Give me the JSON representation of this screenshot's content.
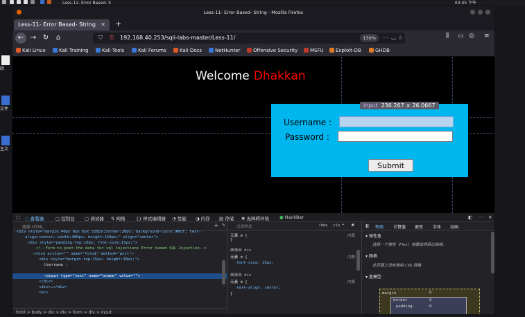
{
  "os": {
    "taskbar_item": "Less-11- Error Based- S",
    "clock": "03:45 下午"
  },
  "desktop": {
    "icon_labels": [
      "回",
      "文件",
      "主文"
    ]
  },
  "browser": {
    "window_title": "Less-11- Error Based- String - Mozilla Firefox",
    "tab_label": "Less-11- Error Based- String",
    "url": "192.168.40.253/sqli-labs-master/Less-11/",
    "zoom": "130%",
    "bookmarks": [
      "Kali Linux",
      "Kali Training",
      "Kali Tools",
      "Kali Forums",
      "Kali Docs",
      "NetHunter",
      "Offensive Security",
      "MSFU",
      "Exploit-DB",
      "GHDB"
    ]
  },
  "page": {
    "welcome": "Welcome",
    "name": "Dhakkan",
    "username_label": "Username :",
    "password_label": "Password :",
    "submit_label": "Submit",
    "inspect_tag": "input",
    "inspect_size": "236.267 × 26.0667"
  },
  "devtools": {
    "tabs": [
      "查看器",
      "控制台",
      "调试器",
      "网络",
      "样式编辑器",
      "性能",
      "内存",
      "存储",
      "无障碍环境",
      "HackBar"
    ],
    "search_placeholder": "搜索 HTML",
    "html_lines": [
      "<div style=\"margin:40px 0px 0px 520px;border:20px; background-color:#0CF; text-",
      "align:center; width:400px; height:150px;\" align=\"center\">",
      "<div style=\"padding-top:10px; font-size:15px;\">",
      "<!--Form to post the data for sql injections Error based SQL Injection-->",
      "<form action=\"\" name=\"form1\" method=\"post\">",
      "<div style=\"margin-top:15px; height:30px;\">",
      "Username :",
      "<input type=\"text\" name=\"uname\" value=\"\">",
      "</div>",
      "<div>…</div>",
      "<br>"
    ],
    "breadcrumbs": "html > body > div > div > form > div > input",
    "rules_filter": "过滤样式",
    "rules_toggles": [
      ":hov",
      ".cls"
    ],
    "rules": [
      {
        "selector": "元素 ⚙ {",
        "body": "}",
        "source": "内联"
      },
      {
        "selector": "继承自 div",
        "body": "",
        "source": ""
      },
      {
        "selector": "元素 ⚙ {",
        "body": "font-size: 15px;",
        "source": "内联"
      },
      {
        "selector": "继承自 div",
        "body": "",
        "source": ""
      },
      {
        "selector": "元素 ⚙ {",
        "body": "text-align: center;",
        "source": "内联"
      }
    ],
    "layout_tabs": [
      "布局",
      "计算值",
      "更改",
      "字体",
      "动画"
    ],
    "flex_title": "弹性盒",
    "flex_hint": "选择一个弹性（Flex）容器或项目以继续。",
    "grid_title": "网格",
    "grid_hint": "此页面上没有使用 CSS 网格",
    "boxmodel_title": "盒模型",
    "box_labels": [
      "margin",
      "border",
      "padding"
    ],
    "box_values": [
      "0",
      "0",
      "0"
    ]
  },
  "colors": {
    "form_bg": "#00b6ef",
    "name_red": "#ff0000",
    "selected_row": "#204e8a"
  }
}
